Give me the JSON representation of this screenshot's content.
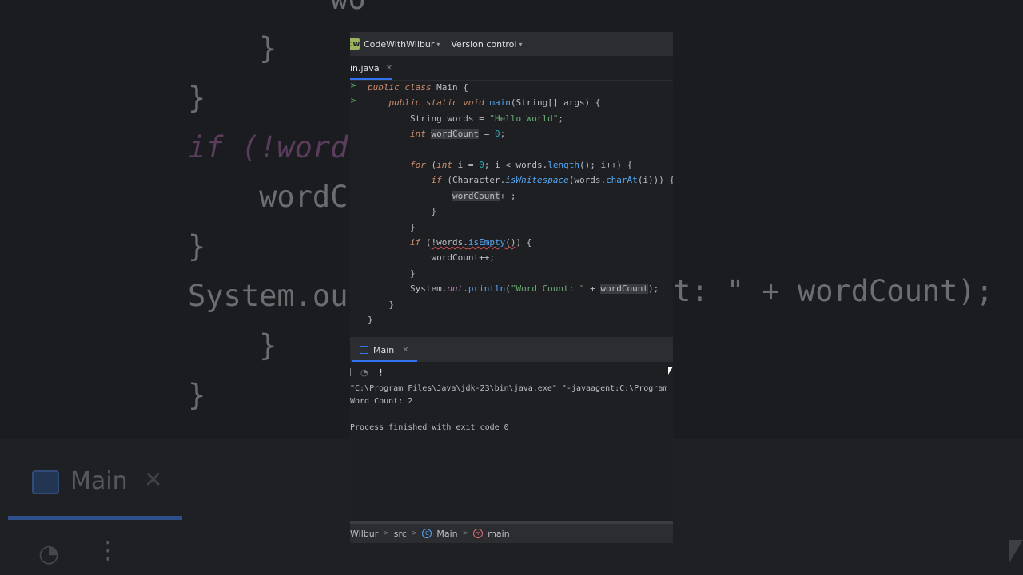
{
  "background": {
    "code_lines": [
      "        wo",
      "    }",
      "}",
      "if (!words",
      "    wordCo",
      "}",
      "System.out",
      "    }",
      "}"
    ],
    "right_fragment": "t: \" + wordCount);",
    "run_tab_label": "Main"
  },
  "topbar": {
    "project_badge": "CW",
    "project_name": "CodeWithWilbur",
    "version_control": "Version control"
  },
  "editor_tab": {
    "file_name": "in.java"
  },
  "code_lines": [
    "public class Main {",
    "    public static void main(String[] args) {",
    "        String words = \"Hello World\";",
    "        int wordCount = 0;",
    "",
    "        for (int i = 0; i < words.length(); i++) {",
    "            if (Character.isWhitespace(words.charAt(i))) {",
    "                wordCount++;",
    "            }",
    "        }",
    "        if (!words.isEmpty()) {",
    "            wordCount++;",
    "        }",
    "        System.out.println(\"Word Count: \" + wordCount);",
    "    }",
    "}"
  ],
  "run_panel": {
    "tab_label": "Main",
    "console_lines": [
      "\"C:\\Program Files\\Java\\jdk-23\\bin\\java.exe\" \"-javaagent:C:\\Program F",
      "Word Count: 2",
      "",
      "Process finished with exit code 0"
    ]
  },
  "statusbar": {
    "crumbs": [
      "Wilbur",
      "src",
      "Main",
      "main"
    ]
  },
  "colors": {
    "accent": "#3574f0",
    "keyword": "#cf8e6d",
    "string": "#6aab73",
    "number": "#2aacb8",
    "method": "#56a8f5",
    "field": "#c77dbb"
  }
}
